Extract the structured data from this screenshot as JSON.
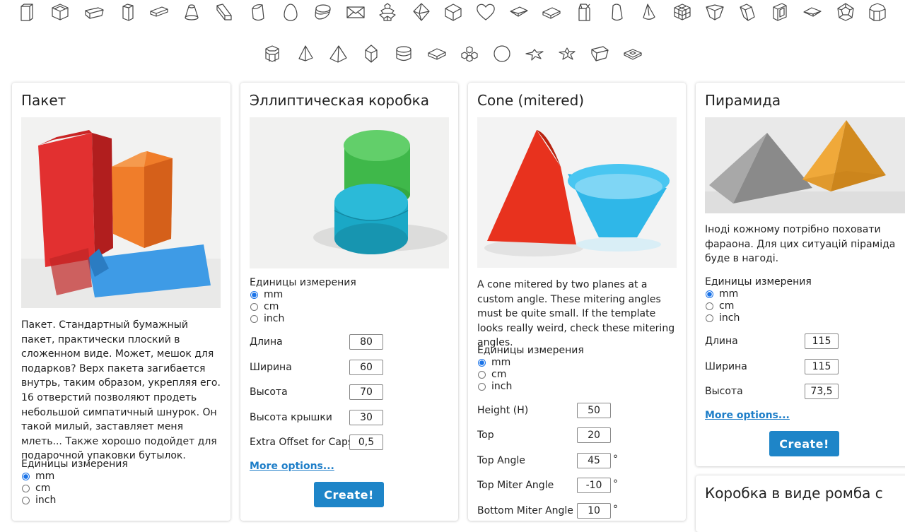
{
  "icon_bar": {
    "row1": [
      "cuboid-icon",
      "cube-box-icon",
      "tray-icon",
      "tall-box-icon",
      "flat-box-icon",
      "frustum-icon",
      "skewed-prism-icon",
      "cylinder-cut-icon",
      "egg-icon",
      "elliptical-box-icon",
      "envelope-icon",
      "flower-box-icon",
      "octahedron-icon",
      "cube-icon",
      "heart-icon",
      "flat-envelope-icon",
      "pillow-box-icon",
      "milk-carton-icon",
      "cone-mitered-icon",
      "cone-icon",
      "cross-cube-icon",
      "boat-tray-icon",
      "tilted-prism-icon",
      "framed-box-icon",
      "diamond-flat-icon",
      "dodecahedron-icon",
      "hexagonal-prism-icon"
    ],
    "row2": [
      "hexagon-box-icon",
      "pyramid-icon",
      "square-pyramid-icon",
      "bipyramid-icon",
      "round-box-icon",
      "rhombus-tray-icon",
      "stacked-cubes-icon",
      "sphere-icon",
      "star-icon",
      "star-box-icon",
      "gem-box-icon",
      "pentagon-tray-icon"
    ]
  },
  "cards": [
    {
      "title": "Пакет",
      "description": "Пакет. Стандартный бумажный пакет, практически плоский в сложенном виде. Может, мешок для подарков? Верх пакета загибается внутрь, таким образом, укрепляя его. 16 отверстий позволяют продеть небольшой симпатичный шнурок. Он такой милый, заставляет меня млеть... Также хорошо подойдет для подарочной упаковки бутылок.",
      "units_title": "Единицы измерения",
      "units": [
        "mm",
        "cm",
        "inch"
      ],
      "selected_unit": "mm"
    },
    {
      "title": "Эллиптическая коробка",
      "units_title": "Единицы измерения",
      "units": [
        "mm",
        "cm",
        "inch"
      ],
      "selected_unit": "mm",
      "fields": [
        {
          "label": "Длина",
          "value": "80"
        },
        {
          "label": "Ширина",
          "value": "60"
        },
        {
          "label": "Высота",
          "value": "70"
        },
        {
          "label": "Высота крышки",
          "value": "30"
        },
        {
          "label": "Extra Offset for Caps",
          "value": "0,5"
        }
      ],
      "more_options": "More options...",
      "create": "Create!"
    },
    {
      "title": "Cone (mitered)",
      "description": "A cone mitered by two planes at a custom angle. These mitering angles must be quite small. If the template looks really weird, check these mitering angles.",
      "units_title": "Единицы измерения",
      "units": [
        "mm",
        "cm",
        "inch"
      ],
      "selected_unit": "mm",
      "fields": [
        {
          "label": "Height (H)",
          "value": "50",
          "suffix": ""
        },
        {
          "label": "Top",
          "value": "20",
          "suffix": ""
        },
        {
          "label": "Top Angle",
          "value": "45",
          "suffix": "°"
        },
        {
          "label": "Top Miter Angle",
          "value": "-10",
          "suffix": "°"
        },
        {
          "label": "Bottom Miter Angle",
          "value": "10",
          "suffix": "°"
        }
      ]
    },
    {
      "title": "Пирамида",
      "description": "Іноді кожному потрібно поховати фараона. Для цих ситуацій піраміда буде в нагоді.",
      "units_title": "Единицы измерения",
      "units": [
        "mm",
        "cm",
        "inch"
      ],
      "selected_unit": "mm",
      "fields": [
        {
          "label": "Длина",
          "value": "115"
        },
        {
          "label": "Ширина",
          "value": "115"
        },
        {
          "label": "Высота",
          "value": "73,5"
        }
      ],
      "more_options": "More options...",
      "create": "Create!"
    },
    {
      "title": "Коробка в виде ромба с"
    }
  ],
  "colors": {
    "accent": "#1e85c8",
    "link": "#1e7ec8"
  }
}
